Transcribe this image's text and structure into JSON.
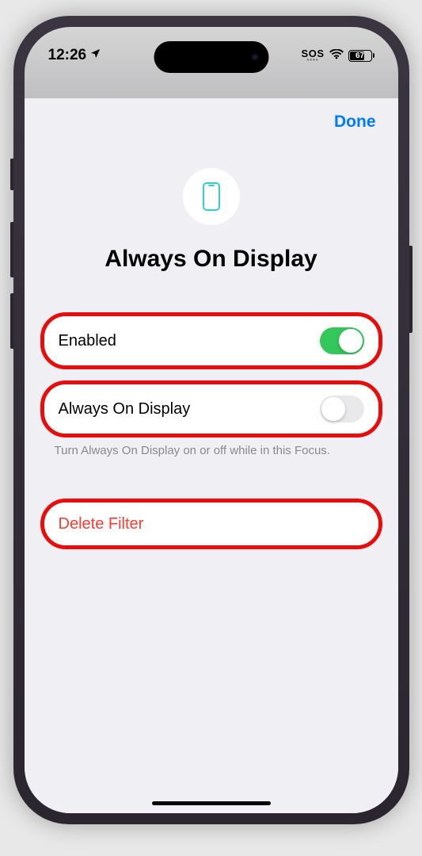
{
  "status_bar": {
    "time": "12:26",
    "sos": "SOS",
    "battery_pct": "67"
  },
  "nav": {
    "done": "Done"
  },
  "header": {
    "title": "Always On Display"
  },
  "rows": {
    "enabled": {
      "label": "Enabled",
      "on": true
    },
    "aod": {
      "label": "Always On Display",
      "on": false
    },
    "aod_footer": "Turn Always On Display on or off while in this Focus.",
    "delete": {
      "label": "Delete Filter"
    }
  },
  "colors": {
    "highlight": "#ea0b0b",
    "link": "#007aff",
    "green": "#34c759",
    "destructive": "#ff3b30"
  }
}
